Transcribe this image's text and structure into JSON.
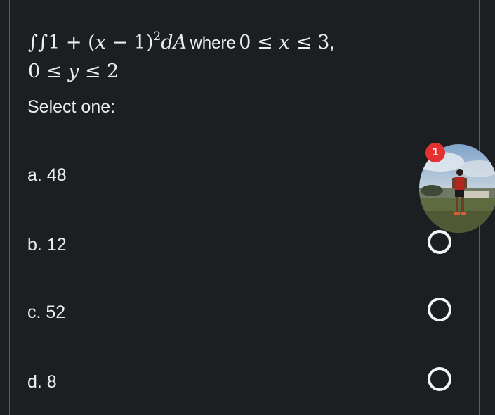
{
  "question": {
    "integrand": "∫∫1 + (x − 1)² dA",
    "where_word": "where",
    "x_range": "0 ≤ x ≤ 3",
    "y_range": "0 ≤ y ≤ 2"
  },
  "prompt": "Select one:",
  "options": [
    {
      "label": "a. 48"
    },
    {
      "label": "b. 12"
    },
    {
      "label": "c. 52"
    },
    {
      "label": "d. 8"
    }
  ],
  "chat_head": {
    "badge_count": "1",
    "badge_color": "#e4312f"
  }
}
